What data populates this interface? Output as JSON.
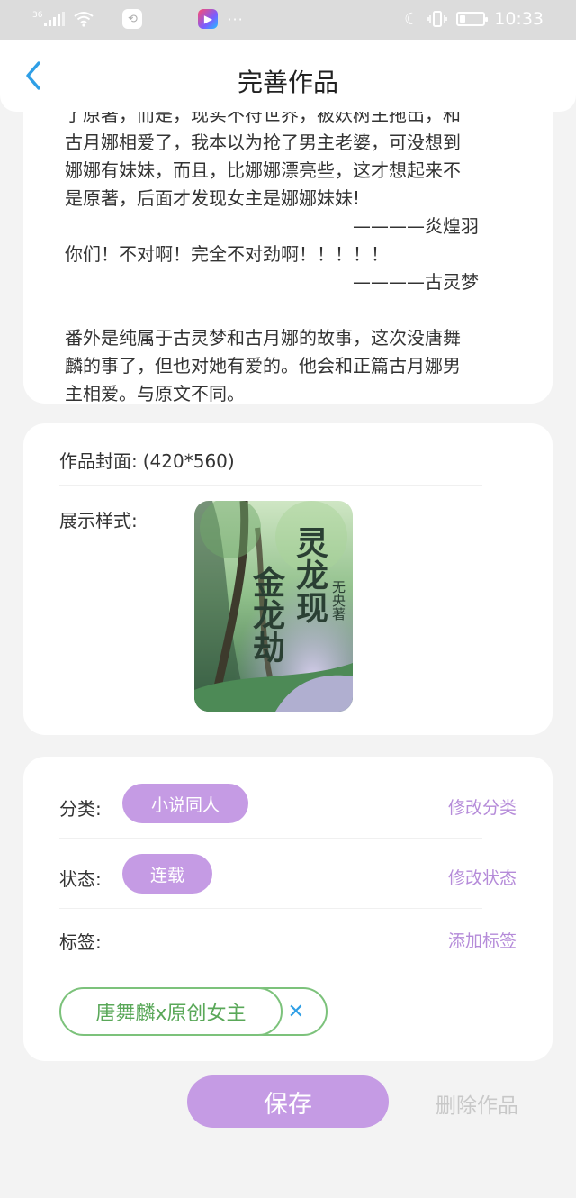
{
  "status_bar": {
    "network": "36",
    "time": "10:33",
    "icons": [
      "signal-icon",
      "wifi-icon",
      "app-notification-icon",
      "video-app-icon",
      "more-icon",
      "moon-icon",
      "vibrate-icon",
      "battery-icon"
    ]
  },
  "header": {
    "title": "完善作品",
    "back_icon": "chevron-left-icon"
  },
  "description": {
    "lines": [
      "了原著，而是，现实不符世界，被妖树主拖出，和",
      "古月娜相爱了，我本以为抢了男主老婆，可没想到",
      "娜娜有妹妹，而且，比娜娜漂亮些，这才想起来不",
      "是原著，后面才发现女主是娜娜妹妹!",
      "————炎煌羽",
      "你们！不对啊！完全不对劲啊！！！！！",
      "————古灵梦",
      "",
      "番外是纯属于古灵梦和古月娜的故事，这次没唐舞",
      "麟的事了，但也对她有爱的。他会和正篇古月娜男",
      "主相爱。与原文不同。"
    ]
  },
  "cover_section": {
    "cover_label": "作品封面:",
    "cover_size": "(420*560)",
    "display_label": "展示样式:",
    "cover_title_left": "金龙劫",
    "cover_title_right": "灵龙现",
    "cover_author": "无央著"
  },
  "meta": {
    "category_label": "分类:",
    "category_value": "小说同人",
    "category_action": "修改分类",
    "status_label": "状态:",
    "status_value": "连载",
    "status_action": "修改状态",
    "tags_label": "标签:",
    "tags_action": "添加标签",
    "tags": [
      "唐舞麟x原创女主"
    ],
    "tag_remove_symbol": "✕"
  },
  "actions": {
    "save_label": "保存",
    "delete_label": "删除作品"
  },
  "colors": {
    "accent_purple": "#c59be4",
    "link_purple": "#b58bd9",
    "tag_green": "#7cc27b",
    "back_blue": "#2f9fe6",
    "disabled_gray": "#c8c8c8"
  }
}
